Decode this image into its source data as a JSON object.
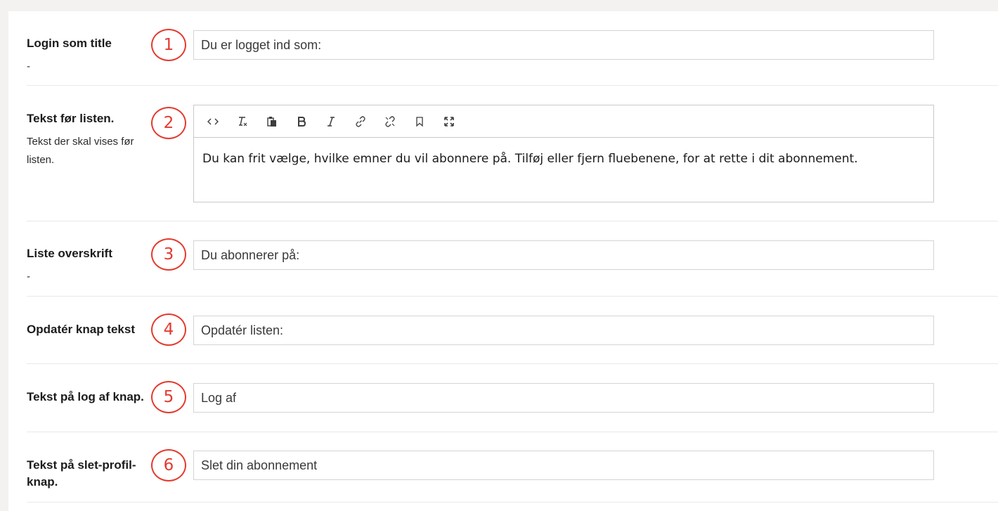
{
  "fields": [
    {
      "number": "1",
      "label": "Login som title",
      "description": "-",
      "value": "Du er logget ind som:"
    },
    {
      "number": "2",
      "label": "Tekst før listen.",
      "description": "Tekst der skal vises før listen.",
      "value": "Du kan frit vælge, hvilke emner du vil abonnere på. Tilføj eller fjern fluebenene, for at rette i dit abonnement."
    },
    {
      "number": "3",
      "label": "Liste overskrift",
      "description": "-",
      "value": "Du abonnerer på:"
    },
    {
      "number": "4",
      "label": "Opdatér knap tekst",
      "value": "Opdatér listen:"
    },
    {
      "number": "5",
      "label": "Tekst på log af knap.",
      "value": "Log af"
    },
    {
      "number": "6",
      "label": "Tekst på slet-profil-knap.",
      "value": "Slet din abonnement"
    }
  ],
  "editor_toolbar": [
    "source-code-icon",
    "remove-format-icon",
    "paste-icon",
    "bold-icon",
    "italic-icon",
    "link-icon",
    "unlink-icon",
    "anchor-icon",
    "maximize-icon"
  ],
  "annotation_color": "#e43a2e"
}
